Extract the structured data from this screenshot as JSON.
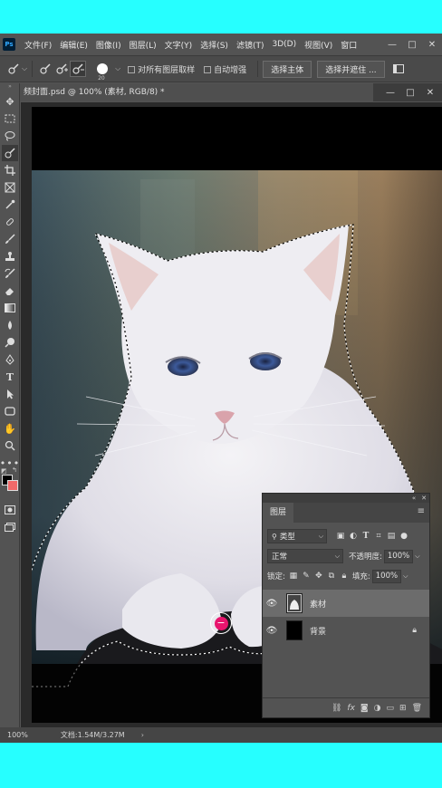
{
  "app": {
    "logo": "Ps",
    "menu": [
      "文件(F)",
      "编辑(E)",
      "图像(I)",
      "图层(L)",
      "文字(Y)",
      "选择(S)",
      "滤镜(T)",
      "3D(D)",
      "视图(V)",
      "窗口"
    ],
    "window_controls": [
      "—",
      "□",
      "✕"
    ]
  },
  "options": {
    "brush_size": "20",
    "sample_all_layers": "对所有图层取样",
    "auto_enhance": "自动增强",
    "select_subject": "选择主体",
    "select_and_mask": "选择并遮住 ..."
  },
  "document": {
    "tab_title": "频封面.psd @ 100% (素材, RGB/8) *",
    "zoom": "100%",
    "doc_info": "文档:1.54M/3.27M"
  },
  "tools": [
    "move",
    "marquee",
    "lasso",
    "quick-select",
    "crop",
    "frame",
    "eyedropper",
    "healing",
    "brush",
    "stamp",
    "history-brush",
    "eraser",
    "gradient",
    "blur",
    "dodge",
    "pen",
    "type",
    "path-select",
    "shape",
    "hand",
    "zoom",
    "more"
  ],
  "layers_panel": {
    "title": "图层",
    "filter_label": "类型",
    "blend_mode": "正常",
    "opacity_label": "不透明度:",
    "opacity_value": "100%",
    "lock_label": "锁定:",
    "fill_label": "填充:",
    "fill_value": "100%",
    "layers": [
      {
        "name": "素材",
        "selected": true,
        "locked": false
      },
      {
        "name": "背景",
        "selected": false,
        "locked": true
      }
    ]
  },
  "colors": {
    "accent_cyan": "#26ffff",
    "foreground": "#000000",
    "background_swatch": "#f06a6a",
    "cursor": "#e8156e"
  }
}
